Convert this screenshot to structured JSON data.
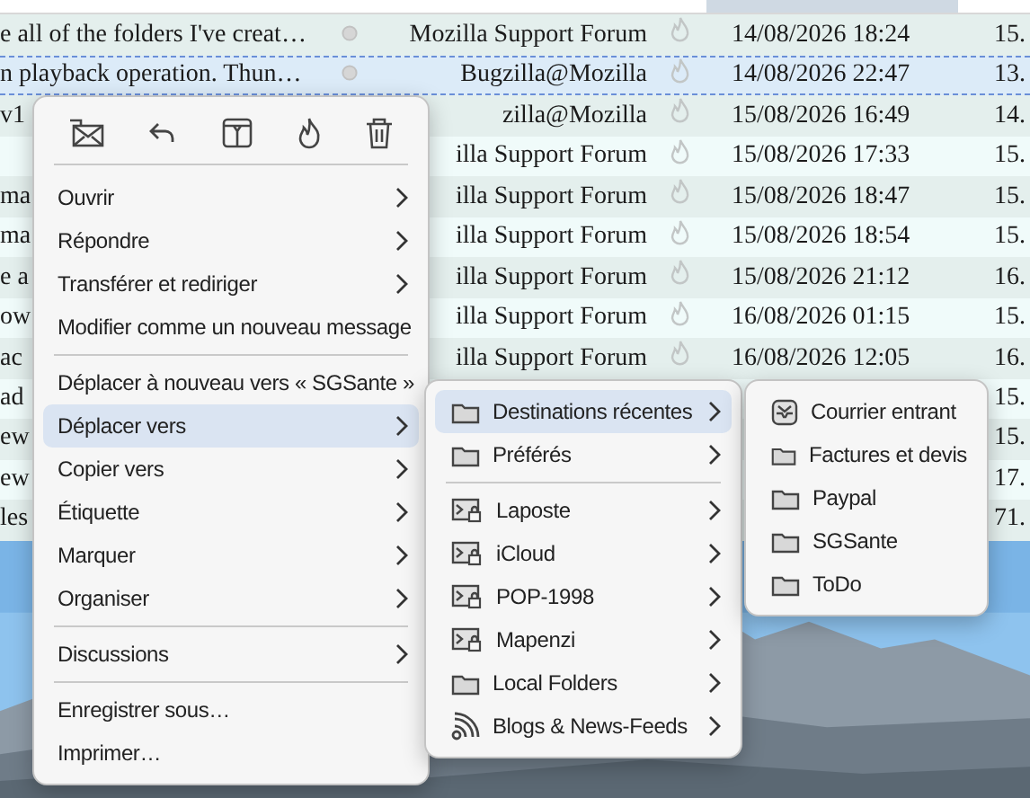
{
  "message_list": {
    "rows": [
      {
        "subject": "e all of the folders I've creat…",
        "sender": "Mozilla Support Forum",
        "date": "14/08/2026 18:24",
        "size": "15.",
        "selected": false
      },
      {
        "subject": "n playback operation. Thun…",
        "sender": "Bugzilla@Mozilla",
        "date": "14/08/2026 22:47",
        "size": "13.",
        "selected": true
      },
      {
        "subject": "v1",
        "sender": "zilla@Mozilla",
        "date": "15/08/2026 16:49",
        "size": "14.",
        "selected": false
      },
      {
        "sender": "illa Support Forum",
        "date": "15/08/2026 17:33",
        "size": "15.",
        "selected": false
      },
      {
        "subject": "ma",
        "sender": "illa Support Forum",
        "date": "15/08/2026 18:47",
        "size": "15.",
        "selected": false
      },
      {
        "subject": "ma",
        "sender": "illa Support Forum",
        "date": "15/08/2026 18:54",
        "size": "15.",
        "selected": false
      },
      {
        "subject": "e a",
        "sender": "illa Support Forum",
        "date": "15/08/2026 21:12",
        "size": "16.",
        "selected": false
      },
      {
        "subject": "ow",
        "sender": "illa Support Forum",
        "date": "16/08/2026 01:15",
        "size": "15.",
        "selected": false
      },
      {
        "subject": "ac",
        "sender": "illa Support Forum",
        "date": "16/08/2026 12:05",
        "size": "16.",
        "selected": false
      },
      {
        "subject": "ad",
        "size": "15.",
        "selected": false
      },
      {
        "subject": "ew",
        "size": "15.",
        "selected": false
      },
      {
        "subject": "ew",
        "size": "17.",
        "selected": false
      },
      {
        "subject": "les",
        "size": "71.",
        "selected": false
      }
    ]
  },
  "context_menu": {
    "items": [
      {
        "kind": "item",
        "label": "Ouvrir",
        "submenu": true,
        "selected": false
      },
      {
        "kind": "item",
        "label": "Répondre",
        "submenu": true,
        "selected": false
      },
      {
        "kind": "item",
        "label": "Transférer et rediriger",
        "submenu": true,
        "selected": false
      },
      {
        "kind": "item",
        "label": "Modifier comme un nouveau message",
        "submenu": false,
        "selected": false
      },
      {
        "kind": "separator"
      },
      {
        "kind": "item",
        "label": "Déplacer à nouveau vers « SGSante »",
        "submenu": false,
        "selected": false
      },
      {
        "kind": "item",
        "label": "Déplacer vers",
        "submenu": true,
        "selected": true
      },
      {
        "kind": "item",
        "label": "Copier vers",
        "submenu": true,
        "selected": false
      },
      {
        "kind": "item",
        "label": "Étiquette",
        "submenu": true,
        "selected": false
      },
      {
        "kind": "item",
        "label": "Marquer",
        "submenu": true,
        "selected": false
      },
      {
        "kind": "item",
        "label": "Organiser",
        "submenu": true,
        "selected": false
      },
      {
        "kind": "separator"
      },
      {
        "kind": "item",
        "label": "Discussions",
        "submenu": true,
        "selected": false
      },
      {
        "kind": "separator"
      },
      {
        "kind": "item",
        "label": "Enregistrer sous…",
        "submenu": false,
        "selected": false
      },
      {
        "kind": "item",
        "label": "Imprimer…",
        "submenu": false,
        "selected": false
      }
    ]
  },
  "move_submenu": {
    "items": [
      {
        "kind": "folder",
        "label": "Destinations récentes",
        "submenu": true,
        "selected": true
      },
      {
        "kind": "folder",
        "label": "Préférés",
        "submenu": true,
        "selected": false
      },
      {
        "kind": "separator"
      },
      {
        "kind": "account",
        "label": "Laposte",
        "submenu": true,
        "selected": false
      },
      {
        "kind": "account",
        "label": "iCloud",
        "submenu": true,
        "selected": false
      },
      {
        "kind": "account",
        "label": "POP-1998",
        "submenu": true,
        "selected": false
      },
      {
        "kind": "account",
        "label": "Mapenzi",
        "submenu": true,
        "selected": false
      },
      {
        "kind": "folder",
        "label": "Local Folders",
        "submenu": true,
        "selected": false
      },
      {
        "kind": "feeds",
        "label": "Blogs & News-Feeds",
        "submenu": true,
        "selected": false
      }
    ]
  },
  "recent_submenu": {
    "items": [
      {
        "kind": "inbox",
        "label": "Courrier entrant",
        "submenu": false,
        "selected": false
      },
      {
        "kind": "folder",
        "label": "Factures et devis",
        "submenu": false,
        "selected": false
      },
      {
        "kind": "folder",
        "label": "Paypal",
        "submenu": false,
        "selected": false
      },
      {
        "kind": "folder",
        "label": "SGSante",
        "submenu": false,
        "selected": false
      },
      {
        "kind": "folder",
        "label": "ToDo",
        "submenu": false,
        "selected": false
      }
    ]
  }
}
